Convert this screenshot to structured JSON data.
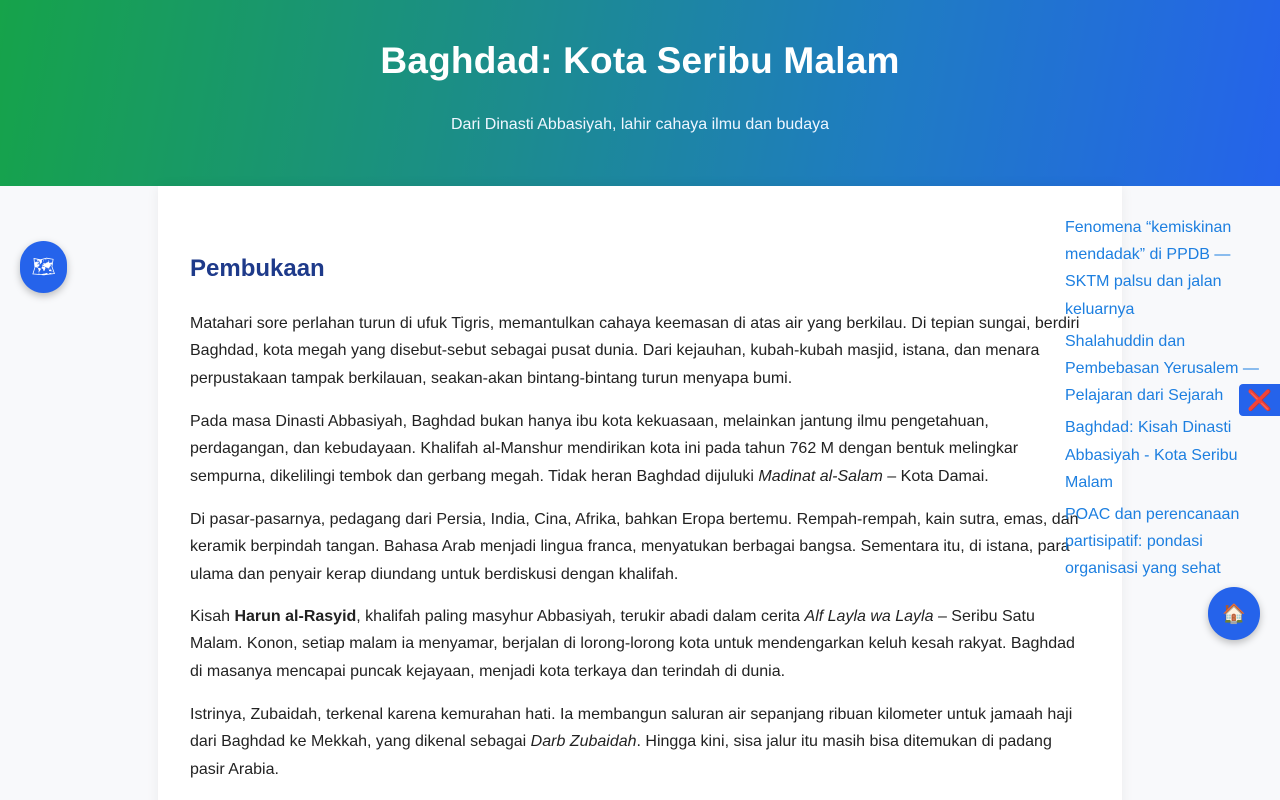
{
  "header": {
    "title": "Baghdad: Kota Seribu Malam",
    "subtitle": "Dari Dinasti Abbasiyah, lahir cahaya ilmu dan budaya"
  },
  "article": {
    "section_title": "Pembukaan",
    "paragraphs": [
      {
        "text": "Matahari sore perlahan turun di ufuk Tigris, memantulkan cahaya keemasan di atas air yang berkilau. Di tepian sungai, berdiri Baghdad, kota megah yang disebut-sebut sebagai pusat dunia. Dari kejauhan, kubah-kubah masjid, istana, dan menara perpustakaan tampak berkilauan, seakan-akan bintang-bintang turun menyapa bumi."
      },
      {
        "before": "Pada masa Dinasti Abbasiyah, Baghdad bukan hanya ibu kota kekuasaan, melainkan jantung ilmu pengetahuan, perdagangan, dan kebudayaan. Khalifah al-Manshur mendirikan kota ini pada tahun 762 M dengan bentuk melingkar sempurna, dikelilingi tembok dan gerbang megah. Tidak heran Baghdad dijuluki ",
        "italic": "Madinat al-Salam",
        "after": " – Kota Damai."
      },
      {
        "text": "Di pasar-pasarnya, pedagang dari Persia, India, Cina, Afrika, bahkan Eropa bertemu. Rempah-rempah, kain sutra, emas, dan keramik berpindah tangan. Bahasa Arab menjadi lingua franca, menyatukan berbagai bangsa. Sementara itu, di istana, para ulama dan penyair kerap diundang untuk berdiskusi dengan khalifah."
      },
      {
        "before": "Kisah ",
        "bold": "Harun al-Rasyid",
        "middle": ", khalifah paling masyhur Abbasiyah, terukir abadi dalam cerita ",
        "italic": "Alf Layla wa Layla",
        "after": " – Seribu Satu Malam. Konon, setiap malam ia menyamar, berjalan di lorong-lorong kota untuk mendengarkan keluh kesah rakyat. Baghdad di masanya mencapai puncak kejayaan, menjadi kota terkaya dan terindah di dunia."
      },
      {
        "before": "Istrinya, Zubaidah, terkenal karena kemurahan hati. Ia membangun saluran air sepanjang ribuan kilometer untuk jamaah haji dari Baghdad ke Mekkah, yang dikenal sebagai ",
        "italic": "Darb Zubaidah",
        "after": ". Hingga kini, sisa jalur itu masih bisa ditemukan di padang pasir Arabia."
      }
    ]
  },
  "related_links": [
    "Fenomena “kemiskinan mendadak” di PPDB — SKTM palsu dan jalan keluarnya",
    "Shalahuddin dan Pembebasan Yerusalem — Pelajaran dari Sejarah",
    "Baghdad: Kisah Dinasti Abbasiyah - Kota Seribu Malam",
    "POAC dan perencanaan partisipatif: pondasi organisasi yang sehat"
  ],
  "buttons": {
    "map_icon": "🗺",
    "home_icon": "🏠",
    "close_icon": "❌"
  },
  "colors": {
    "hero_gradient_start": "#16a34a",
    "hero_gradient_end": "#2563eb",
    "section_title": "#1e3a8a",
    "link": "#1d7fe0",
    "fab": "#2563eb"
  }
}
